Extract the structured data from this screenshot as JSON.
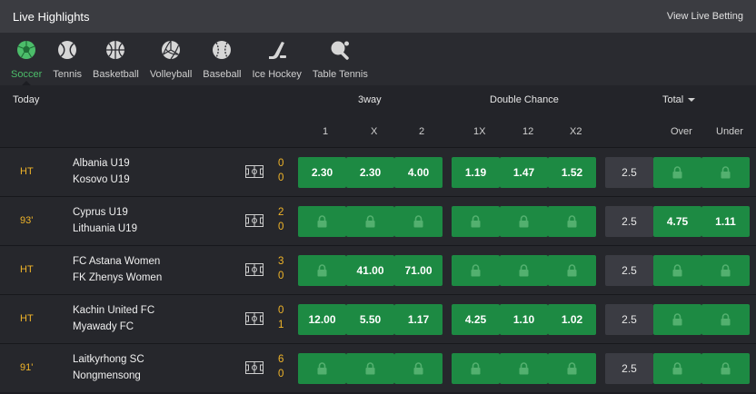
{
  "header": {
    "title": "Live Highlights",
    "view_link": "View Live Betting"
  },
  "sports": [
    {
      "label": "Soccer",
      "icon": "soccer-ball-icon",
      "active": true
    },
    {
      "label": "Tennis",
      "icon": "tennis-ball-icon",
      "active": false
    },
    {
      "label": "Basketball",
      "icon": "basketball-icon",
      "active": false
    },
    {
      "label": "Volleyball",
      "icon": "volleyball-icon",
      "active": false
    },
    {
      "label": "Baseball",
      "icon": "baseball-icon",
      "active": false
    },
    {
      "label": "Ice Hockey",
      "icon": "hockey-stick-icon",
      "active": false
    },
    {
      "label": "Table Tennis",
      "icon": "table-tennis-icon",
      "active": false
    }
  ],
  "table_header": {
    "today": "Today",
    "market_3way": "3way",
    "market_double": "Double Chance",
    "market_total": "Total",
    "cols_3way": [
      "1",
      "X",
      "2"
    ],
    "cols_double": [
      "1X",
      "12",
      "X2"
    ],
    "cols_total": [
      "Over",
      "Under"
    ]
  },
  "matches": [
    {
      "time": "HT",
      "home": "Albania U19",
      "away": "Kosovo U19",
      "score_home": "0",
      "score_away": "0",
      "three_way": [
        "2.30",
        "2.30",
        "4.00"
      ],
      "double": [
        "1.19",
        "1.47",
        "1.52"
      ],
      "total_line": "2.5",
      "total": [
        "lock",
        "lock"
      ]
    },
    {
      "time": "93'",
      "home": "Cyprus U19",
      "away": "Lithuania U19",
      "score_home": "2",
      "score_away": "0",
      "three_way": [
        "lock",
        "lock",
        "lock"
      ],
      "double": [
        "lock",
        "lock",
        "lock"
      ],
      "total_line": "2.5",
      "total": [
        "4.75",
        "1.11"
      ]
    },
    {
      "time": "HT",
      "home": "FC Astana Women",
      "away": "FK Zhenys Women",
      "score_home": "3",
      "score_away": "0",
      "three_way": [
        "lock",
        "41.00",
        "71.00"
      ],
      "double": [
        "lock",
        "lock",
        "lock"
      ],
      "total_line": "2.5",
      "total": [
        "lock",
        "lock"
      ]
    },
    {
      "time": "HT",
      "home": "Kachin United FC",
      "away": "Myawady FC",
      "score_home": "0",
      "score_away": "1",
      "three_way": [
        "12.00",
        "5.50",
        "1.17"
      ],
      "double": [
        "4.25",
        "1.10",
        "1.02"
      ],
      "total_line": "2.5",
      "total": [
        "lock",
        "lock"
      ]
    },
    {
      "time": "91'",
      "home": "Laitkyrhong SC",
      "away": "Nongmensong",
      "score_home": "6",
      "score_away": "0",
      "three_way": [
        "lock",
        "lock",
        "lock"
      ],
      "double": [
        "lock",
        "lock",
        "lock"
      ],
      "total_line": "2.5",
      "total": [
        "lock",
        "lock"
      ]
    }
  ],
  "colors": {
    "accent_green": "#1d8a43",
    "score_yellow": "#f0b429",
    "active_tab": "#4cbd6a"
  }
}
